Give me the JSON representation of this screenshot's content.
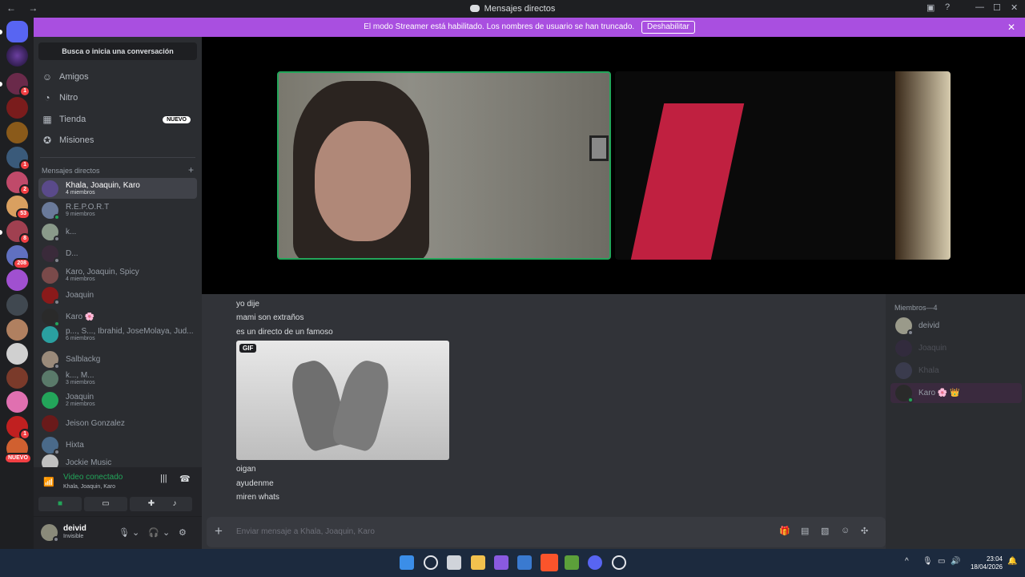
{
  "window": {
    "title": "Mensajes directos",
    "nav": "← →"
  },
  "banner": {
    "text": "El modo Streamer está habilitado. Los nombres de usuario se han truncado.",
    "button": "Deshabilitar",
    "close": "✕"
  },
  "guilds": [
    {
      "badge": ""
    },
    {
      "badge": ""
    },
    {
      "badge": "1"
    },
    {
      "badge": ""
    },
    {
      "badge": ""
    },
    {
      "badge": "1"
    },
    {
      "badge": "2"
    },
    {
      "badge": "53"
    },
    {
      "badge": "8"
    },
    {
      "badge": "208"
    },
    {
      "badge": ""
    },
    {
      "badge": ""
    },
    {
      "badge": ""
    },
    {
      "badge": ""
    },
    {
      "badge": ""
    },
    {
      "badge": ""
    },
    {
      "badge": "1"
    },
    {
      "badge": "NUEVO"
    }
  ],
  "sidebar": {
    "search": "Busca o inicia una conversación",
    "nav": [
      {
        "label": "Amigos",
        "icon": "friends-icon"
      },
      {
        "label": "Nitro",
        "icon": "nitro-icon"
      },
      {
        "label": "Tienda",
        "icon": "shop-icon",
        "badge": "NUEVO"
      },
      {
        "label": "Misiones",
        "icon": "quests-icon"
      }
    ],
    "dm_header": "Mensajes directos",
    "dm_add": "+",
    "dms": [
      {
        "name": "Khala, Joaquin, Karo",
        "sub": "4 miembros",
        "active": true
      },
      {
        "name": "R.E.P.O.R.T",
        "sub": "9 miembros"
      },
      {
        "name": "k...",
        "sub": ""
      },
      {
        "name": "D...",
        "sub": ""
      },
      {
        "name": "Karo, Joaquin, Spicy",
        "sub": "4 miembros"
      },
      {
        "name": "Joaquin",
        "sub": ""
      },
      {
        "name": "Karo 🌸",
        "sub": ""
      },
      {
        "name": "p..., S..., Ibrahid, JoseMolaya, Jud...",
        "sub": "6 miembros"
      },
      {
        "name": "Salblackg",
        "sub": ""
      },
      {
        "name": "k..., M...",
        "sub": "3 miembros"
      },
      {
        "name": "Joaquin",
        "sub": "2 miembros"
      },
      {
        "name": "Jeison Gonzalez",
        "sub": ""
      },
      {
        "name": "Hixta",
        "sub": ""
      },
      {
        "name": "Jockie Music",
        "sub": ""
      }
    ]
  },
  "voice": {
    "title": "Video conectado",
    "sub": "Khala, Joaquin, Karo"
  },
  "user": {
    "name": "deivid",
    "status": "Invisible"
  },
  "chat": {
    "messages": [
      "yo dije",
      "mami son extraños",
      "es un directo de un famoso"
    ],
    "gif_label": "GIF",
    "messages_after": [
      "oigan",
      "ayudenme",
      "miren whats"
    ],
    "placeholder": "Enviar mensaje a Khala, Joaquin, Karo",
    "plus": "+"
  },
  "members": {
    "header": "Miembros—4",
    "list": [
      {
        "name": "deivid",
        "color": "#949ba4"
      },
      {
        "name": "Joaquin",
        "color": "#4e5058"
      },
      {
        "name": "Khala",
        "color": "#4e5058"
      },
      {
        "name": "Karo 🌸 👑",
        "color": "#949ba4"
      }
    ]
  },
  "taskbar": {
    "time": "23:04",
    "date": "18/04/2026"
  }
}
